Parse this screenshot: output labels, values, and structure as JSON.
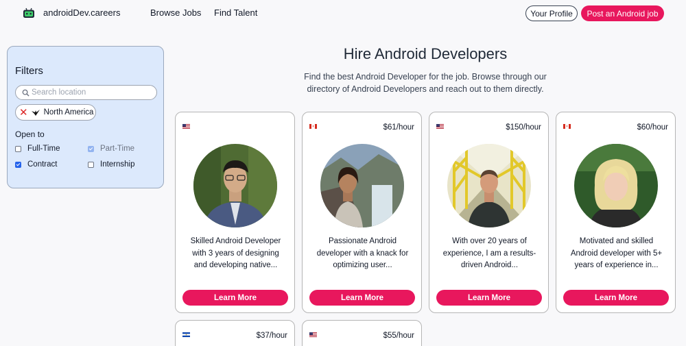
{
  "header": {
    "brand": "androidDev.careers",
    "nav": [
      "Browse Jobs",
      "Find Talent"
    ],
    "profile_label": "Your Profile",
    "post_label": "Post an Android job",
    "accent": "#e8175d"
  },
  "filters": {
    "title": "Filters",
    "search_placeholder": "Search location",
    "chip_label": "North America",
    "open_to_label": "Open to",
    "options": [
      {
        "label": "Full-Time",
        "checked": false
      },
      {
        "label": "Part-Time",
        "checked": true
      },
      {
        "label": "Contract",
        "checked": true
      },
      {
        "label": "Internship",
        "checked": false
      }
    ]
  },
  "hero": {
    "title": "Hire Android Developers",
    "subtitle": "Find the best Android Developer for the job. Browse through our directory of Android Developers and reach out to them directly."
  },
  "cards": [
    {
      "flag": "us",
      "rate": "",
      "bio": "Skilled Android Developer with 3 years of designing and developing native...",
      "cta": "Learn More"
    },
    {
      "flag": "ca",
      "rate": "$61/hour",
      "bio": "Passionate Android developer with a knack for optimizing user...",
      "cta": "Learn More"
    },
    {
      "flag": "us",
      "rate": "$150/hour",
      "bio": "With over 20 years of experience, I am a results-driven Android...",
      "cta": "Learn More"
    },
    {
      "flag": "ca",
      "rate": "$60/hour",
      "bio": "Motivated and skilled Android developer with 5+ years of experience in...",
      "cta": "Learn More"
    },
    {
      "flag": "sv",
      "rate": "$37/hour",
      "bio": "",
      "cta": ""
    },
    {
      "flag": "us",
      "rate": "$55/hour",
      "bio": "",
      "cta": ""
    }
  ]
}
